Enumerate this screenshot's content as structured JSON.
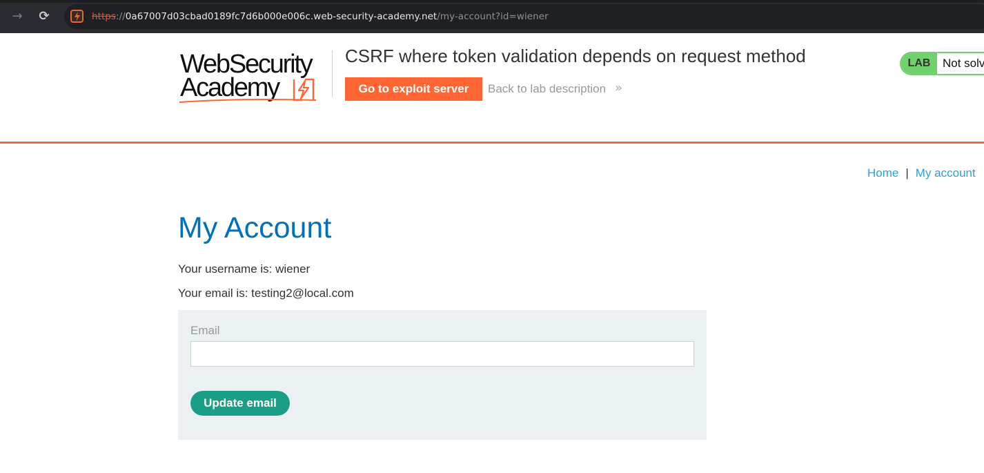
{
  "browser": {
    "url_scheme": "https",
    "url_separator": "://",
    "url_host": "0a67007d03cbad0189fc7d6b000e006c.web-security-academy.net",
    "url_path": "/my-account?id=wiener",
    "icons": {
      "forward": "forward-arrow-icon",
      "reload": "reload-icon",
      "site": "site-lightning-icon"
    }
  },
  "header": {
    "logo_line1": "WebSecurity",
    "logo_line2": "Academy",
    "lab_title": "CSRF where token validation depends on request method",
    "exploit_button": "Go to exploit server",
    "back_link": "Back to lab description",
    "back_icon": "double-chevron-right-icon",
    "status_badge": "LAB",
    "status_text": "Not solved"
  },
  "nav": {
    "home": "Home",
    "separator": "|",
    "my_account": "My account"
  },
  "main": {
    "title": "My Account",
    "username_text": "Your username is: wiener",
    "email_text": "Your email is: testing2@local.com",
    "form": {
      "email_label": "Email",
      "email_value": "",
      "submit_label": "Update email"
    }
  },
  "colors": {
    "accent_orange": "#ff6633",
    "title_blue": "#0071bc",
    "link_blue": "#29a0d8",
    "status_green": "#70d16d",
    "button_teal": "#1a9e85",
    "panel_gray": "#ebf0f2"
  }
}
